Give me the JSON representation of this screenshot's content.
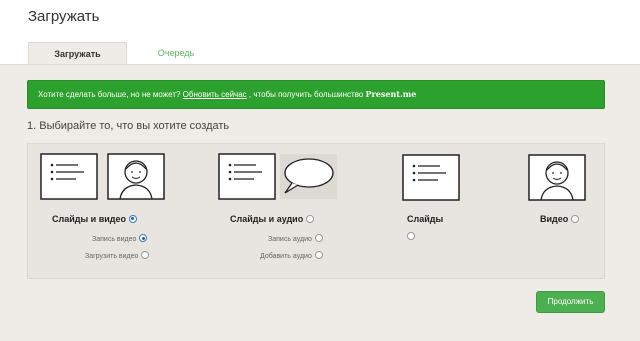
{
  "header": {
    "title": "Загружать"
  },
  "tabs": [
    {
      "label": "Загружать"
    },
    {
      "label": "Очередь"
    }
  ],
  "banner": {
    "text_before": "Хотите сделать больше, но не может? ",
    "link": "Обновить сейчас",
    "text_after": " , чтобы получить большинство ",
    "brand": "Present.me"
  },
  "step": {
    "label": "1. Выбирайте то, что вы хотите создать"
  },
  "options": [
    {
      "label": "Слайды и видео",
      "selected": true,
      "sub": [
        {
          "label": "Запись видео",
          "selected": true
        },
        {
          "label": "Загрузить видео",
          "selected": false
        }
      ]
    },
    {
      "label": "Слайды и аудио",
      "selected": false,
      "sub": [
        {
          "label": "Запись аудио",
          "selected": false
        },
        {
          "label": "Добавить аудио",
          "selected": false
        }
      ]
    },
    {
      "label": "Слайды",
      "selected": false
    },
    {
      "label": "Видео",
      "selected": false
    }
  ],
  "actions": {
    "continue": "Продолжить"
  },
  "colors": {
    "banner": "#2da12d",
    "button": "#4caf50",
    "tab_inactive": "#5cb85c",
    "content_bg": "#efebe6"
  }
}
